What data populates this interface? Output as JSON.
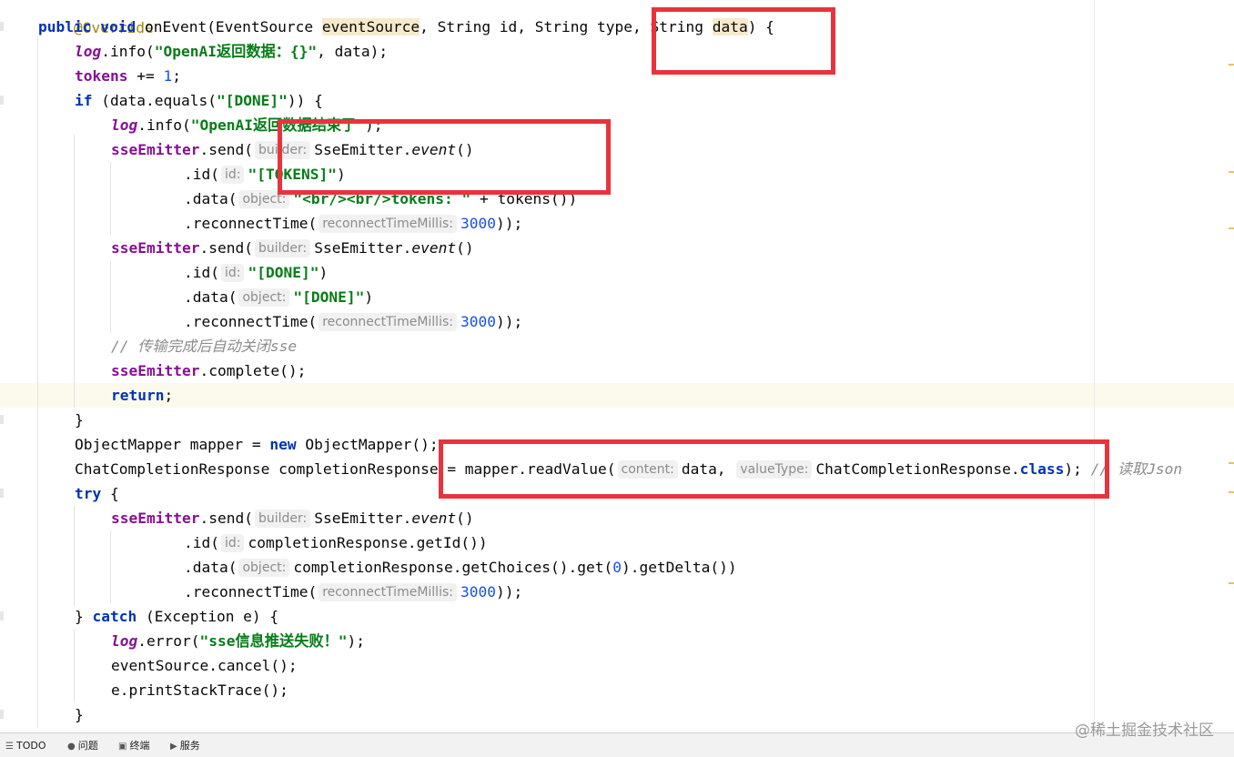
{
  "editor": {
    "line1": {
      "annotation": "@Override"
    },
    "line2": {
      "kw_public": "public",
      "kw_void": "void",
      "method": "onEvent(EventSource ",
      "p1": "eventSource",
      "rest": ", String id, String type, String ",
      "p2": "data",
      "tail": ") {"
    },
    "line3": {
      "log": "log",
      "call": ".info(",
      "str": "\"OpenAI返回数据：{}\"",
      "tail": ", data);"
    },
    "line4": {
      "field": "tokens",
      "op": " += ",
      "num": "1",
      "tail": ";"
    },
    "line5": {
      "kw": "if",
      "pre": " (data.equals(",
      "str": "\"[DONE]\"",
      "tail": ")) {"
    },
    "line6": {
      "log": "log",
      "call": ".info(",
      "str": "\"OpenAI返回数据结束了\"",
      "tail": ");"
    },
    "line7": {
      "field": "sseEmitter",
      "call": ".send(",
      "hint": "builder:",
      "cls": "SseEmitter.",
      "method": "event",
      "tail": "()"
    },
    "line8": {
      "call": ".id(",
      "hint": "id:",
      "str": "\"[TOKENS]\"",
      "tail": ")"
    },
    "line9": {
      "call": ".data(",
      "hint": "object:",
      "str": "\"<br/><br/>tokens: \"",
      "tail": " + tokens())"
    },
    "line10": {
      "call": ".reconnectTime(",
      "hint": "reconnectTimeMillis:",
      "num": "3000",
      "tail": "));"
    },
    "line11": {
      "field": "sseEmitter",
      "call": ".send(",
      "hint": "builder:",
      "cls": "SseEmitter.",
      "method": "event",
      "tail": "()"
    },
    "line12": {
      "call": ".id(",
      "hint": "id:",
      "str": "\"[DONE]\"",
      "tail": ")"
    },
    "line13": {
      "call": ".data(",
      "hint": "object:",
      "str": "\"[DONE]\"",
      "tail": ")"
    },
    "line14": {
      "call": ".reconnectTime(",
      "hint": "reconnectTimeMillis:",
      "num": "3000",
      "tail": "));"
    },
    "line15": {
      "comment": "// 传输完成后自动关闭sse"
    },
    "line16": {
      "field": "sseEmitter",
      "tail": ".complete();"
    },
    "line17": {
      "kw": "return",
      "tail": ";"
    },
    "line18": {
      "text": "}"
    },
    "line19": {
      "pre": "ObjectMapper mapper = ",
      "kw": "new",
      "tail": " ObjectMapper();"
    },
    "line20": {
      "pre": "ChatCompletionResponse completionResponse = mapper.readValue(",
      "hint1": "content:",
      "mid": "data, ",
      "hint2": "valueType:",
      "cls": "ChatCompletionResponse.",
      "kw": "class",
      "tail": ");",
      "comment": "// 读取Json"
    },
    "line21": {
      "kw": "try",
      "tail": " {"
    },
    "line22": {
      "field": "sseEmitter",
      "call": ".send(",
      "hint": "builder:",
      "cls": "SseEmitter.",
      "method": "event",
      "tail": "()"
    },
    "line23": {
      "call": ".id(",
      "hint": "id:",
      "tail": "completionResponse.getId())"
    },
    "line24": {
      "call": ".data(",
      "hint": "object:",
      "pre": "completionResponse.getChoices().get(",
      "num": "0",
      "tail": ").getDelta())"
    },
    "line25": {
      "call": ".reconnectTime(",
      "hint": "reconnectTimeMillis:",
      "num": "3000",
      "tail": "));"
    },
    "line26": {
      "pre": "} ",
      "kw": "catch",
      "tail": " (Exception e) {"
    },
    "line27": {
      "log": "log",
      "call": ".error(",
      "str": "\"sse信息推送失败！\"",
      "tail": ");"
    },
    "line28": {
      "text": "eventSource.cancel();"
    },
    "line29": {
      "text": "e.printStackTrace();"
    },
    "line30": {
      "text": "}"
    }
  },
  "statusbar": {
    "items": [
      {
        "icon": "todo-list-icon",
        "label": "TODO"
      },
      {
        "icon": "problems-icon",
        "label": "问题"
      },
      {
        "icon": "terminal-icon",
        "label": "终端"
      },
      {
        "icon": "services-icon",
        "label": "服务"
      }
    ]
  },
  "watermark": "@稀土掘金技术社区",
  "colors": {
    "keyword": "#0033b3",
    "string": "#067d17",
    "number": "#1750eb",
    "field": "#871094",
    "annotation_box": "#e8333d"
  }
}
